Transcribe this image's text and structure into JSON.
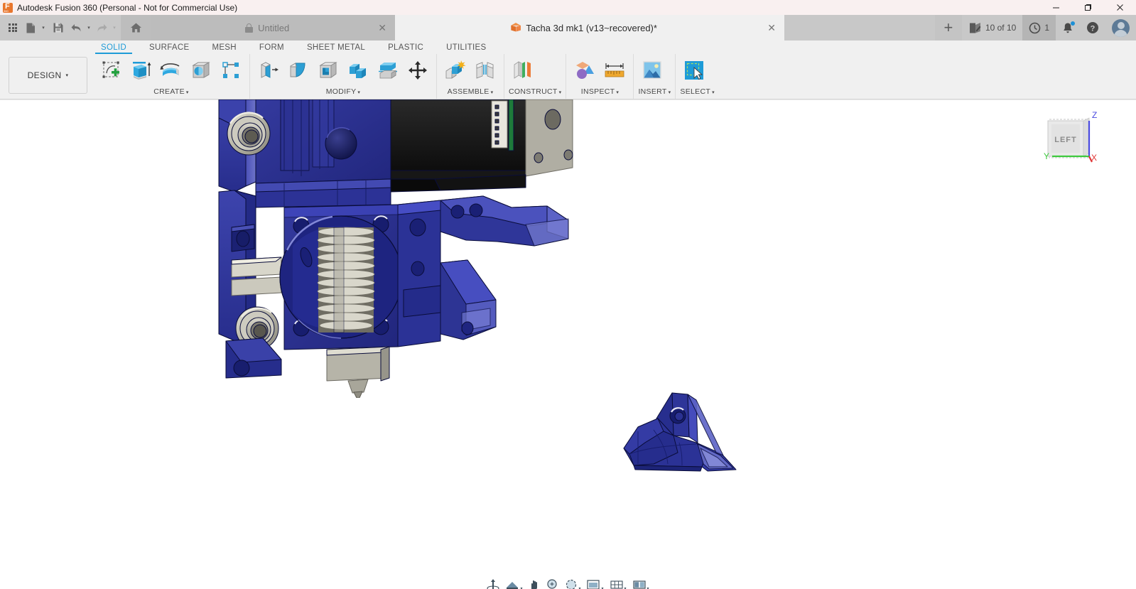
{
  "window": {
    "title": "Autodesk Fusion 360 (Personal - Not for Commercial Use)",
    "logo_text": "F",
    "logo_sub": "360",
    "minimize_label": "—",
    "maximize_label": "❐",
    "close_label": "✕"
  },
  "quick_access": {
    "app_grid": "apps-grid-icon",
    "new_file": "new-file-icon",
    "save": "save-icon",
    "undo": "undo-icon",
    "redo": "redo-icon",
    "home": "home-icon",
    "caret": "▾"
  },
  "tabs": [
    {
      "label": "Untitled",
      "icon": "lock-icon",
      "active": false,
      "close": "✕"
    },
    {
      "label": "Tacha 3d mk1 (v13~recovered)*",
      "icon": "cube-icon",
      "active": true,
      "close": "✕"
    }
  ],
  "tab_add": "+",
  "status_right": {
    "jobs_label": "10 of 10",
    "jobs_icon": "edit-document-icon",
    "clock_count": "1",
    "clock_icon": "clock-icon",
    "notifications_icon": "bell-icon",
    "help_icon": "help-icon",
    "avatar_icon": "user-avatar"
  },
  "ribbon": {
    "workspace": {
      "label": "DESIGN",
      "caret": "▾"
    },
    "tabs": [
      {
        "label": "SOLID",
        "active": true
      },
      {
        "label": "SURFACE",
        "active": false
      },
      {
        "label": "MESH",
        "active": false
      },
      {
        "label": "FORM",
        "active": false
      },
      {
        "label": "SHEET METAL",
        "active": false
      },
      {
        "label": "PLASTIC",
        "active": false
      },
      {
        "label": "UTILITIES",
        "active": false
      }
    ],
    "panels": [
      {
        "label": "CREATE",
        "caret": "▾",
        "tools": [
          {
            "name": "create-sketch-icon"
          },
          {
            "name": "extrude-icon"
          },
          {
            "name": "revolve-icon"
          },
          {
            "name": "hole-icon"
          },
          {
            "name": "rectangular-pattern-icon"
          }
        ]
      },
      {
        "label": "MODIFY",
        "caret": "▾",
        "tools": [
          {
            "name": "press-pull-icon"
          },
          {
            "name": "fillet-icon"
          },
          {
            "name": "shell-icon"
          },
          {
            "name": "combine-icon"
          },
          {
            "name": "split-body-icon"
          },
          {
            "name": "move-copy-icon"
          }
        ]
      },
      {
        "label": "ASSEMBLE",
        "caret": "▾",
        "tools": [
          {
            "name": "new-component-icon"
          },
          {
            "name": "joint-icon"
          }
        ]
      },
      {
        "label": "CONSTRUCT",
        "caret": "▾",
        "tools": [
          {
            "name": "offset-plane-icon"
          }
        ]
      },
      {
        "label": "INSPECT",
        "caret": "▾",
        "tools": [
          {
            "name": "interference-icon"
          },
          {
            "name": "measure-icon"
          }
        ]
      },
      {
        "label": "INSERT",
        "caret": "▾",
        "tools": [
          {
            "name": "insert-canvas-icon"
          }
        ]
      },
      {
        "label": "SELECT",
        "caret": "▾",
        "tools": [
          {
            "name": "select-window-icon"
          }
        ]
      }
    ]
  },
  "viewcube": {
    "face_label": "LEFT",
    "axis_z": "Z",
    "axis_y": "Y",
    "axis_x": "X",
    "color_z": "#4a4ae0",
    "color_y": "#3ec93e",
    "color_x": "#e03535"
  },
  "canvas": {
    "background": "#ffffff",
    "model_primary_color": "#2a2f93",
    "model_metal_color": "#b9b9ae",
    "model_dark_color": "#1a1a1a",
    "models": [
      {
        "name": "extruder-hotend-assembly"
      },
      {
        "name": "fan-duct-bracket"
      }
    ]
  },
  "navbar": {
    "caret": "▾",
    "buttons": [
      {
        "name": "orbit-icon",
        "caret": false
      },
      {
        "name": "look-at-icon",
        "caret": true
      },
      {
        "name": "pan-icon",
        "caret": false
      },
      {
        "name": "zoom-icon",
        "caret": false
      },
      {
        "name": "fit-icon",
        "caret": true
      },
      {
        "name": "display-settings-icon",
        "caret": true
      },
      {
        "name": "grid-snap-icon",
        "caret": true
      },
      {
        "name": "viewports-icon",
        "caret": true
      }
    ]
  }
}
